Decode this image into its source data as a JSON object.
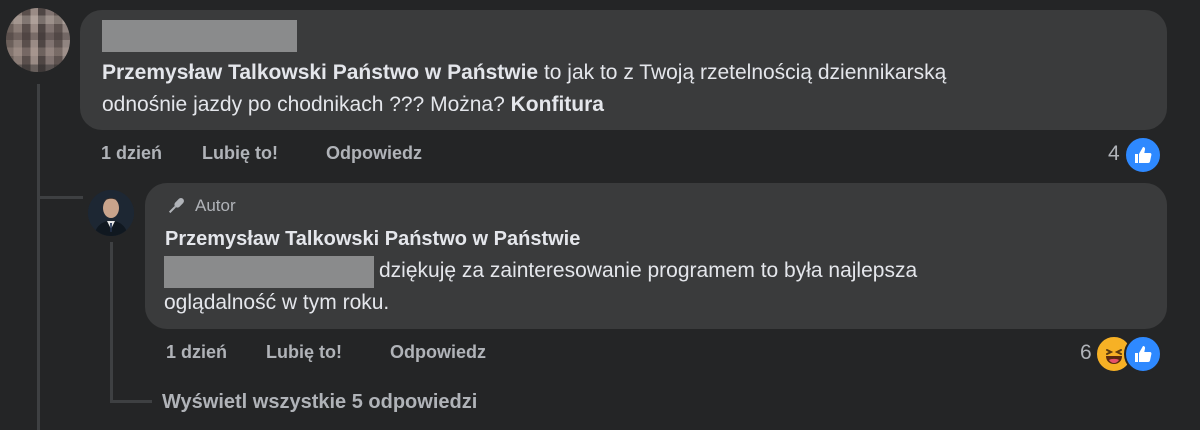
{
  "comment": {
    "mention_bold": "Przemysław Talkowski Państwo w Państwie",
    "text_line1_rest": " to jak to z Twoją rzetelnością dziennikarską",
    "text_line2": "odnośnie jazdy po chodnikach ??? Można? ",
    "text_line2_bold": "Konfitura",
    "time": "1 dzień",
    "like_label": "Lubię to!",
    "reply_label": "Odpowiedz",
    "reaction_count": "4",
    "reactions": [
      "like-icon"
    ]
  },
  "reply": {
    "author_badge": "Autor",
    "author_name": "Przemysław Talkowski Państwo w Państwie",
    "text_line1": "dziękuję za zainteresowanie programem to była najlepsza",
    "text_line2": "oglądalność w tym roku.",
    "time": "1 dzień",
    "like_label": "Lubię to!",
    "reply_label": "Odpowiedz",
    "reaction_count": "6",
    "reactions": [
      "haha-icon",
      "like-icon"
    ]
  },
  "view_all_replies": "Wyświetl wszystkie 5 odpowiedzi",
  "colors": {
    "background": "#242526",
    "bubble": "#3a3b3c",
    "like_blue": "#2e89ff",
    "muted_text": "#b0b3b8"
  }
}
